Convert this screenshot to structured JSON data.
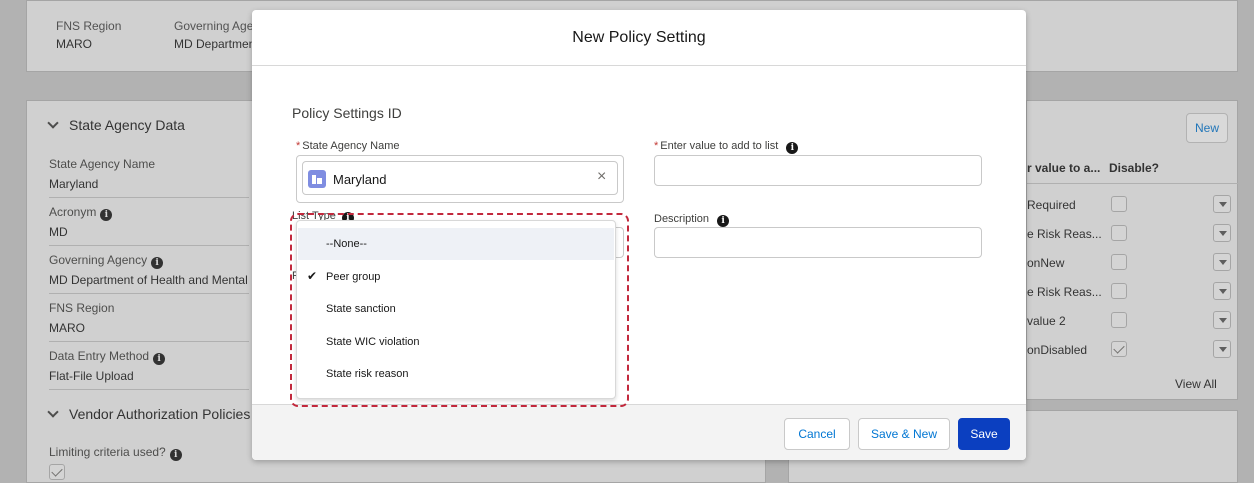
{
  "background": {
    "top_card": {
      "col1_label": "FNS Region",
      "col1_value": "MARO",
      "col2_label": "Governing Age",
      "col2_value": "MD Departmen"
    },
    "state_agency_section": {
      "title": "State Agency Data",
      "fields": [
        {
          "label": "State Agency Name",
          "value": "Maryland"
        },
        {
          "label": "Acronym",
          "value": "MD"
        },
        {
          "label": "Governing Agency",
          "value": "MD Department of Health and Mental Hy"
        },
        {
          "label": "FNS Region",
          "value": "MARO"
        },
        {
          "label": "Data Entry Method",
          "value": "Flat-File Upload"
        }
      ]
    },
    "vendor_section": {
      "title": "Vendor Authorization Policies",
      "limiting_label": "Limiting criteria used?"
    },
    "related_list": {
      "new_button": "New",
      "col_value": "r value to a...",
      "col_disable": "Disable?",
      "rows": [
        {
          "value": "Required",
          "disabled": false
        },
        {
          "value": "e Risk Reas...",
          "disabled": false
        },
        {
          "value": "onNew",
          "disabled": false
        },
        {
          "value": "e Risk Reas...",
          "disabled": false
        },
        {
          "value": "value 2",
          "disabled": false
        },
        {
          "value": "onDisabled",
          "disabled": true
        }
      ],
      "view_all": "View All"
    }
  },
  "modal": {
    "title": "New Policy Setting",
    "section_title": "Policy Settings ID",
    "state_agency_label": "State Agency Name",
    "state_agency_value": "Maryland",
    "enter_value_label": "Enter value to add to list",
    "list_type_label": "List Type",
    "description_label": "Description",
    "hidden_label_fragment": "F",
    "list_type_options": [
      {
        "label": "--None--",
        "selected": false,
        "highlighted": true
      },
      {
        "label": "Peer group",
        "selected": true,
        "highlighted": false
      },
      {
        "label": "State sanction",
        "selected": false,
        "highlighted": false
      },
      {
        "label": "State WIC violation",
        "selected": false,
        "highlighted": false
      },
      {
        "label": "State risk reason",
        "selected": false,
        "highlighted": false
      }
    ],
    "buttons": {
      "cancel": "Cancel",
      "save_new": "Save & New",
      "save": "Save"
    }
  },
  "colors": {
    "brand": "#0b3fc0",
    "link": "#0176d3",
    "required": "#c23934",
    "focus_ring": "#c2283c",
    "record_icon": "#7f8de1"
  }
}
